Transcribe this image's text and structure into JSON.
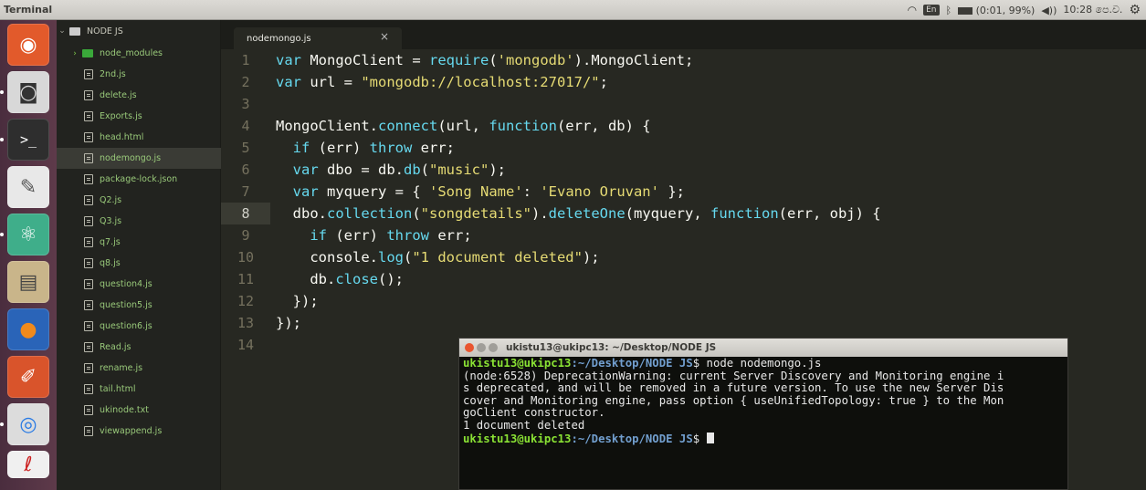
{
  "top_panel": {
    "title": "Terminal",
    "lang": "En",
    "battery": "(0:01, 99%)",
    "clock": "10:28 පෙ.ව."
  },
  "sidebar": {
    "root": "NODE JS",
    "folder": "node_modules",
    "files": [
      "2nd.js",
      "delete.js",
      "Exports.js",
      "head.html",
      "nodemongo.js",
      "package-lock.json",
      "Q2.js",
      "Q3.js",
      "q7.js",
      "q8.js",
      "question4.js",
      "question5.js",
      "question6.js",
      "Read.js",
      "rename.js",
      "tail.html",
      "ukinode.txt",
      "viewappend.js"
    ],
    "selected_index": 4
  },
  "editor": {
    "tab_label": "nodemongo.js",
    "tab_close": "×",
    "line_numbers": [
      "1",
      "2",
      "3",
      "4",
      "5",
      "6",
      "7",
      "8",
      "9",
      "10",
      "11",
      "12",
      "13",
      "14"
    ],
    "active_line": 8
  },
  "code": {
    "l1a": "var",
    "l1b": " MongoClient = ",
    "l1c": "require",
    "l1d": "(",
    "l1e": "'mongodb'",
    "l1f": ").MongoClient;",
    "l2a": "var",
    "l2b": " url = ",
    "l2c": "\"mongodb://localhost:27017/\"",
    "l2d": ";",
    "l4a": "MongoClient.",
    "l4b": "connect",
    "l4c": "(url, ",
    "l4d": "function",
    "l4e": "(err, db) {",
    "l5a": "  ",
    "l5b": "if",
    "l5c": " (err) ",
    "l5d": "throw",
    "l5e": " err;",
    "l6a": "  ",
    "l6b": "var",
    "l6c": " dbo = db.",
    "l6d": "db",
    "l6e": "(",
    "l6f": "\"music\"",
    "l6g": ");",
    "l7a": "  ",
    "l7b": "var",
    "l7c": " myquery = { ",
    "l7d": "'Song Name'",
    "l7e": ": ",
    "l7f": "'Evano Oruvan'",
    "l7g": " };",
    "l8a": "  dbo.",
    "l8b": "collection",
    "l8c": "(",
    "l8d": "\"songdetails\"",
    "l8e": ").",
    "l8f": "deleteOne",
    "l8g": "(myquery, ",
    "l8h": "function",
    "l8i": "(err, obj) {",
    "l9a": "    ",
    "l9b": "if",
    "l9c": " (err) ",
    "l9d": "throw",
    "l9e": " err;",
    "l10a": "    console.",
    "l10b": "log",
    "l10c": "(",
    "l10d": "\"1 document deleted\"",
    "l10e": ");",
    "l11a": "    db.",
    "l11b": "close",
    "l11c": "();",
    "l12": "  });",
    "l13": "});"
  },
  "terminal": {
    "title": "ukistu13@ukipc13: ~/Desktop/NODE JS",
    "prompt_user": "ukistu13@ukipc13",
    "prompt_path": ":~/Desktop/NODE JS",
    "prompt_sign": "$ ",
    "command": "node nodemongo.js",
    "out1": "(node:6528) DeprecationWarning: current Server Discovery and Monitoring engine i",
    "out2": "s deprecated, and will be removed in a future version. To use the new Server Dis",
    "out3": "cover and Monitoring engine, pass option { useUnifiedTopology: true } to the Mon",
    "out4": "goClient constructor.",
    "out5": "1 document deleted"
  },
  "colors": {
    "editor_bg": "#272822",
    "string": "#e6db74",
    "keyword": "#66d9ef",
    "function": "#a6e22e",
    "sidebar_text": "#99c97a",
    "prompt_green": "#8ae234",
    "prompt_blue": "#729fcf"
  }
}
